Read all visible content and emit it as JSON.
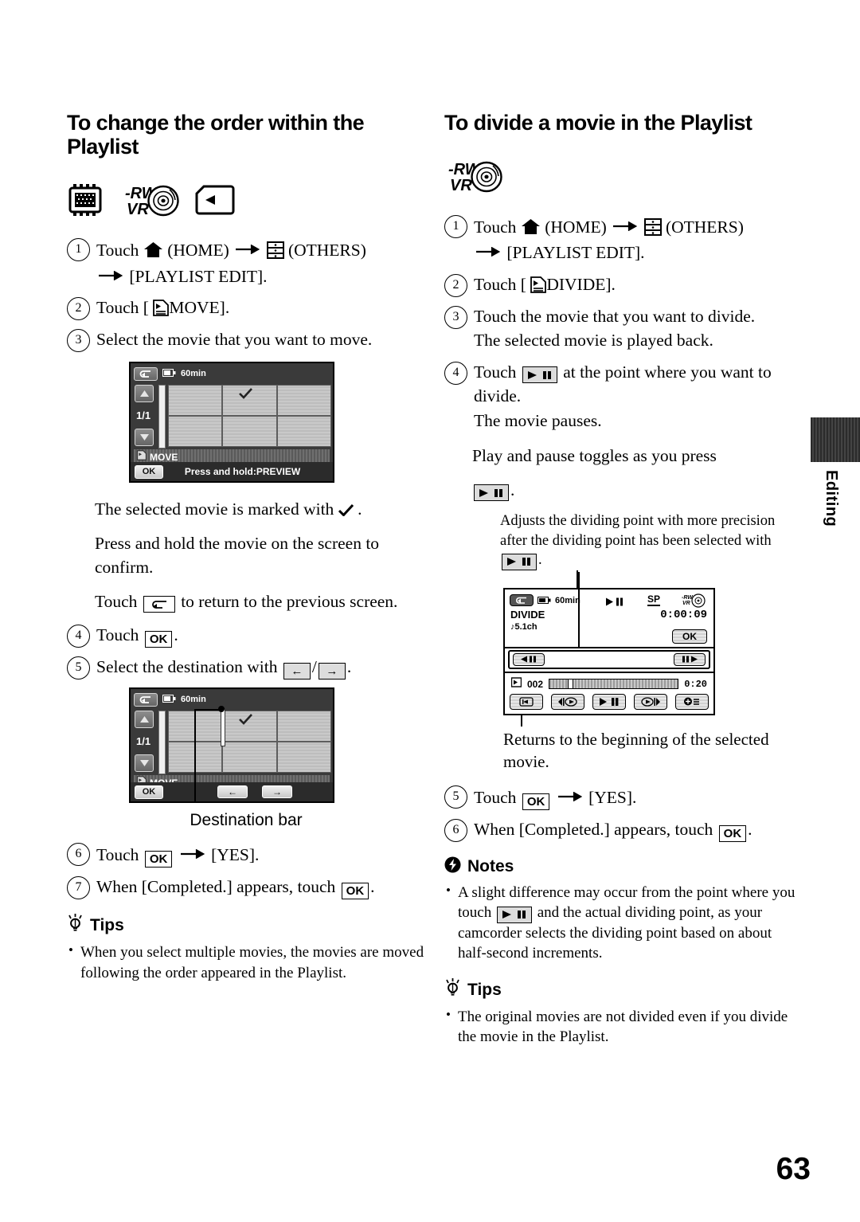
{
  "page": {
    "number": "63",
    "side_tab_label": "Editing"
  },
  "left": {
    "title": "To change the order within the Playlist",
    "media_icons": [
      "memory-chip-icon",
      "dvd-rw-vr-icon",
      "memory-card-icon"
    ],
    "steps": [
      {
        "num": "1",
        "text_a": "Touch",
        "home_label": "(HOME)",
        "others_label": "(OTHERS)",
        "text_b": "[PLAYLIST EDIT]."
      },
      {
        "num": "2",
        "text": "Touch [",
        "button": "MOVE",
        "text_end": "]."
      },
      {
        "num": "3",
        "text": "Select the movie that you want to move."
      },
      {
        "num": "4",
        "text": "Touch",
        "key": "OK",
        "text_end": "."
      },
      {
        "num": "5",
        "text": "Select the destination with",
        "key_left": "←",
        "key_right": "→",
        "text_end": "."
      },
      {
        "num": "6",
        "text": "Touch",
        "key": "OK",
        "text_mid": "[YES]."
      },
      {
        "num": "7",
        "text_a": "When [Completed.] appears, touch",
        "key": "OK",
        "text_end": "."
      }
    ],
    "paragraphs": [
      "The selected movie is marked with",
      "Press and hold the movie on the screen to confirm.",
      "to return to the previous screen."
    ],
    "touch_word": "Touch",
    "lcd1": {
      "battery": "60min",
      "page_indicator": "1/1",
      "mode_label": "MOVE",
      "ok_label": "OK",
      "hint": "Press and hold:PREVIEW",
      "back_icon": "return-arrow-icon",
      "up_icon": "scroll-up-icon",
      "down_icon": "scroll-down-icon",
      "check_icon": "checkmark-icon"
    },
    "lcd2": {
      "battery": "60min",
      "page_indicator": "1/1",
      "mode_label": "MOVE",
      "ok_label": "OK",
      "left_label": "←",
      "right_label": "→"
    },
    "lcd2_caption": "Destination bar",
    "tips_head": "Tips",
    "tips": [
      "When you select multiple movies, the movies are moved following the order appeared in the Playlist."
    ]
  },
  "right": {
    "title": "To divide a movie in the Playlist",
    "media_icons": [
      "dvd-rw-vr-icon"
    ],
    "steps": [
      {
        "num": "1",
        "text_a": "Touch",
        "home_label": "(HOME)",
        "others_label": "(OTHERS)",
        "text_b": "[PLAYLIST EDIT]."
      },
      {
        "num": "2",
        "text": "Touch [",
        "button": "DIVIDE",
        "text_end": "]."
      },
      {
        "num": "3",
        "text": "Touch the movie that you want to divide.",
        "sub": "The selected movie is played back."
      },
      {
        "num": "4",
        "text_a": "Touch",
        "text_b": "at the point where you want to divide.",
        "sub": "The movie pauses."
      },
      {
        "num": "5",
        "text": "Touch",
        "key": "OK",
        "text_mid": "[YES]."
      },
      {
        "num": "6",
        "text_a": "When [Completed.] appears, touch",
        "key": "OK",
        "text_end": "."
      }
    ],
    "toggle_para": "Play and pause toggles as you press",
    "callout_adjust": "Adjusts the dividing point with more precision after the dividing point has been selected with",
    "callout_returns": "Returns to the beginning of the selected movie.",
    "lcd_divide": {
      "title": "DIVIDE",
      "audio": "♪5.1ch",
      "battery": "60min",
      "mode": "SP",
      "timecode": "0:00:09",
      "ok_label": "OK",
      "clip_number": "002",
      "duration": "0:20",
      "back_icon": "return-arrow-icon",
      "disc_icon": "disc-icon",
      "playpause_icon": "play-pause-icon",
      "frame_back_icon": "frame-back-icon",
      "frame_fwd_icon": "frame-forward-icon",
      "return-start_icon": "return-to-start-icon",
      "prev_icon": "previous-icon",
      "next_icon": "next-icon",
      "vol_icon": "volume-icon"
    },
    "notes_head": "Notes",
    "notes": [
      {
        "a": "A slight difference may occur from the point where you touch",
        "b": "and the actual dividing point, as your camcorder selects the dividing point based on about half-second increments."
      }
    ],
    "tips_head": "Tips",
    "tips": [
      "The original movies are not divided even if you divide the movie in the Playlist."
    ]
  }
}
